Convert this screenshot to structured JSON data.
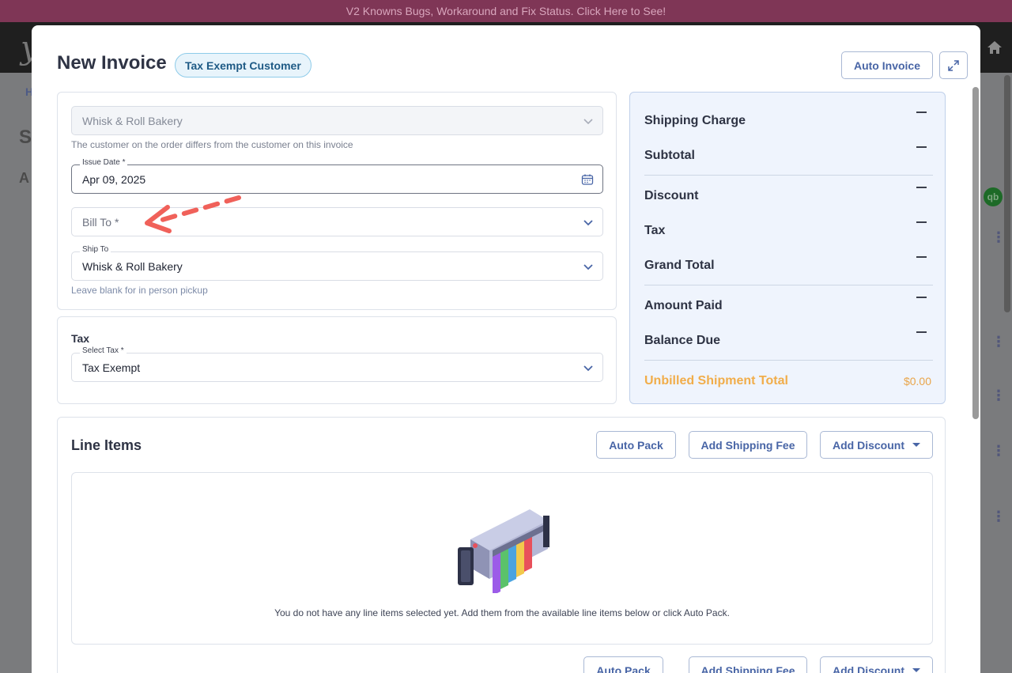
{
  "banner": {
    "text": "V2 Knowns Bugs, Workaround and Fix Status. Click Here to See!"
  },
  "background": {
    "logo": "y",
    "crumb": "H",
    "title_letter": "S",
    "sub_letter": "A",
    "qb_badge": "qb"
  },
  "modal": {
    "title": "New Invoice",
    "badge": "Tax Exempt Customer",
    "auto_invoice_label": "Auto Invoice"
  },
  "customer": {
    "value": "Whisk & Roll Bakery",
    "helper": "The customer on the order differs from the customer on this invoice"
  },
  "issue_date": {
    "label": "Issue Date *",
    "value": "Apr 09, 2025"
  },
  "bill_to": {
    "placeholder": "Bill To *"
  },
  "ship_to": {
    "label": "Ship To",
    "value": "Whisk & Roll Bakery",
    "helper": "Leave blank for in person pickup"
  },
  "tax": {
    "section_label": "Tax",
    "select_label": "Select Tax *",
    "value": "Tax Exempt"
  },
  "summary": {
    "rows": [
      {
        "label": "Shipping Charge"
      },
      {
        "label": "Subtotal"
      },
      {
        "label": "Discount"
      },
      {
        "label": "Tax"
      },
      {
        "label": "Grand Total"
      },
      {
        "label": "Amount Paid"
      },
      {
        "label": "Balance Due"
      }
    ],
    "unbilled_label": "Unbilled Shipment Total",
    "unbilled_value": "$0.00"
  },
  "line_items": {
    "title": "Line Items",
    "auto_pack_label": "Auto Pack",
    "add_shipping_label": "Add Shipping Fee",
    "add_discount_label": "Add Discount",
    "empty_text": "You do not have any line items selected yet. Add them from the available line items below or click Auto Pack."
  },
  "colors": {
    "accent": "#4865a6",
    "banner": "#7f3656",
    "summary_bg": "#eff4fd",
    "unbilled": "#f1ad4a",
    "annotation_arrow": "#f0615a"
  }
}
